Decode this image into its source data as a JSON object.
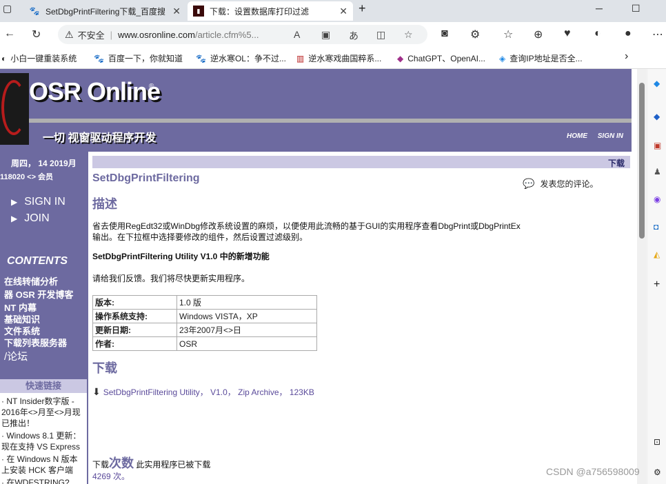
{
  "browser": {
    "tabs": [
      {
        "title": "SetDbgPrintFiltering下载_百度搜",
        "icon": "paw-icon"
      },
      {
        "title": "下载：设置数据库打印过滤",
        "icon": "osr-favicon"
      }
    ],
    "new_tab": "+",
    "address": {
      "security": "不安全",
      "url_main": "www.osronline.com",
      "url_path": "/article.cfm%5..."
    },
    "favorites": [
      {
        "label": "小白一键重装系统"
      },
      {
        "label": "百度一下，你就知道"
      },
      {
        "label": "逆水寒OL：争不过..."
      },
      {
        "label": "逆水寒戏曲国粹系..."
      },
      {
        "label": "ChatGPT、OpenAI..."
      },
      {
        "label": "查询IP地址是否全..."
      }
    ],
    "favorites_more": "›"
  },
  "site": {
    "title": "OSR Online",
    "reg": "®",
    "tagline": "一切 视窗驱动程序开发",
    "links": [
      "HOME",
      "SIGN IN"
    ]
  },
  "sidebar": {
    "date": "周四， 14 2019月",
    "member": "118020 <> 会员",
    "nav": [
      "SIGN IN",
      "JOIN"
    ],
    "contents_head": "CONTENTS",
    "contents": [
      "在线转储分析",
      "器 OSR 开发博客",
      "NT 内幕",
      "基础知识",
      "文件系统",
      "下载列表服务器",
      "/论坛"
    ],
    "quick_head": "快速链接",
    "quick_links": [
      "· NT Insider数字版 - 2016年<>月至<>月现已推出！",
      "· Windows 8.1 更新：现在支持 VS Express",
      "· 在 Windows N 版本上安装 HCK 客户端",
      "· 在WDFSTRING?"
    ]
  },
  "main": {
    "download_link": "下载",
    "title": "SetDbgPrintFiltering",
    "comment": "发表您的评论。",
    "desc_head": "描述",
    "desc": "省去使用RegEdt32或WinDbg修改系统设置的麻烦，以便使用此流畅的基于GUI的实用程序查看DbgPrint或DbgPrintEx输出。在下拉框中选择要修改的组件，然后设置过滤级别。",
    "new_features": "SetDbgPrintFiltering Utility V1.0 中的新增功能",
    "feedback": "请给我们反馈。我们将尽快更新实用程序。",
    "table": [
      {
        "key": "版本:",
        "value": "1.0 版"
      },
      {
        "key": "操作系统支持:",
        "value": "Windows VISTA，XP"
      },
      {
        "key": "更新日期:",
        "value": "23年2007月<>日"
      },
      {
        "key": "作者:",
        "value": "OSR"
      }
    ],
    "dl_head": "下载",
    "file": "SetDbgPrintFiltering Utility， V1.0， Zip Archive， 123KB",
    "count_prefix": "下载",
    "count_big": "次数",
    "count_suffix": " 此实用程序已被下载",
    "count_value": "4269 次。"
  },
  "watermark": "CSDN @a756598009"
}
